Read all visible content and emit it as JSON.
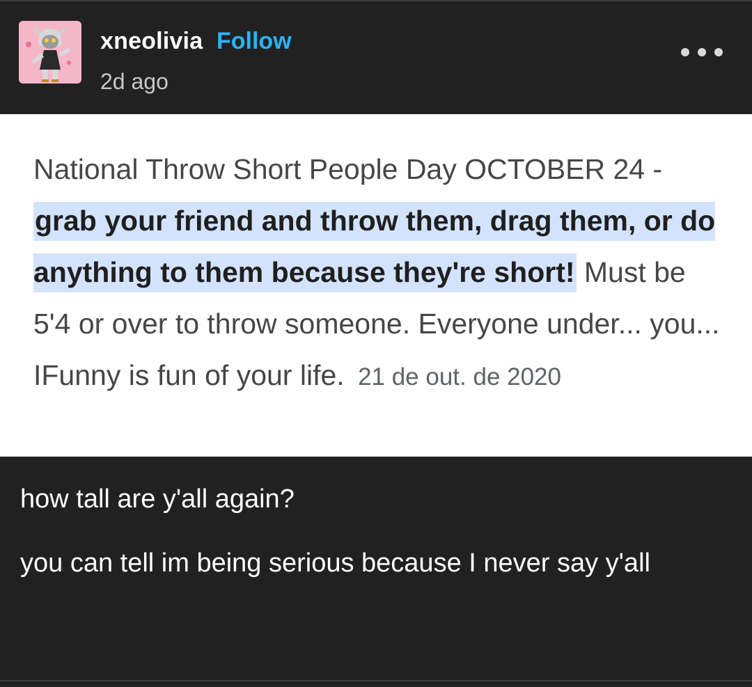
{
  "header": {
    "username": "xneolivia",
    "follow_label": "Follow",
    "timestamp": "2d ago",
    "more_icon": "more-horizontal-icon"
  },
  "embed": {
    "text_before": "National Throw Short People Day OCTOBER 24 - ",
    "highlighted": "grab your friend and throw them, drag them, or do anything to them because they're short!",
    "text_after": " Must be 5'4 or over to throw someone. Everyone under... you... IFunny is fun of your life.",
    "date": "21 de out. de 2020"
  },
  "caption": {
    "line1": "how tall are y'all again?",
    "line2": "you can tell im being serious because I never say y'all"
  },
  "colors": {
    "background": "#212121",
    "follow": "#2bb3f3",
    "highlight": "#d3e3fd"
  }
}
